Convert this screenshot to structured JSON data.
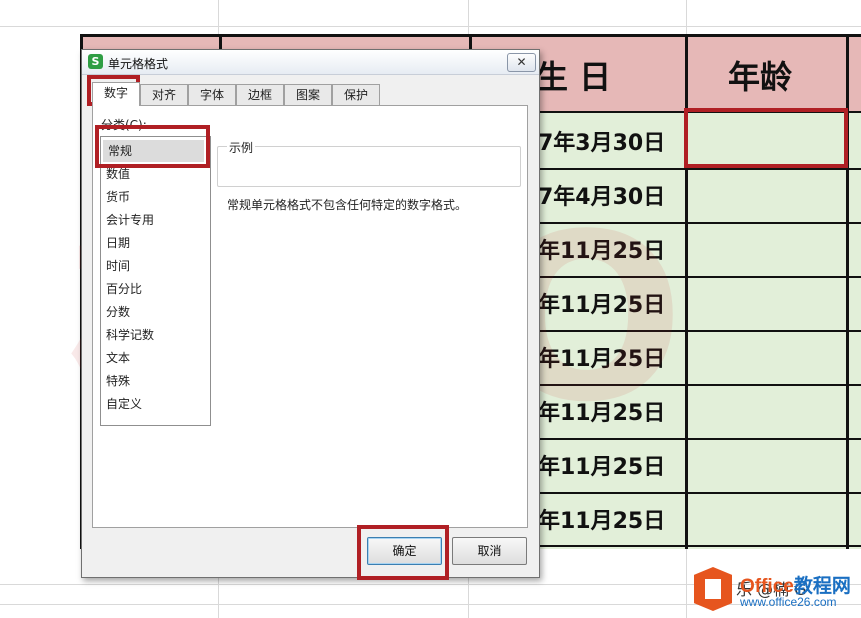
{
  "dialog": {
    "title": "单元格格式",
    "app_icon_glyph": "S",
    "close_glyph": "✕",
    "tabs": [
      "数字",
      "对齐",
      "字体",
      "边框",
      "图案",
      "保护"
    ],
    "active_tab": "数字",
    "category_label": "分类(C):",
    "categories": [
      "常规",
      "数值",
      "货币",
      "会计专用",
      "日期",
      "时间",
      "百分比",
      "分数",
      "科学记数",
      "文本",
      "特殊",
      "自定义"
    ],
    "selected_category": "常规",
    "sample_label": "示例",
    "description": "常规单元格格式不包含任何特定的数字格式。",
    "ok_label": "确定",
    "cancel_label": "取消"
  },
  "sheet": {
    "header_birthday": "生 日",
    "header_age": "年龄",
    "dates": [
      "7年3月30日",
      "7年4月30日",
      "年11月25日",
      "年11月25日",
      "年11月25日",
      "年11月25日",
      "年11月25日",
      "年11月25日"
    ],
    "header_fill_color": "#e6b8b7",
    "body_fill_color": "#e2efd9"
  },
  "watermark": {
    "text": "楠GO"
  },
  "logo": {
    "brand_prefix": "Office",
    "brand_suffix": "教程网",
    "url": "www.office26.com"
  },
  "bottom_text": "乐 @楠 G",
  "colors": {
    "highlight_red": "#b01f24",
    "office_orange": "#e6551e",
    "office_blue": "#1a6fc2"
  }
}
